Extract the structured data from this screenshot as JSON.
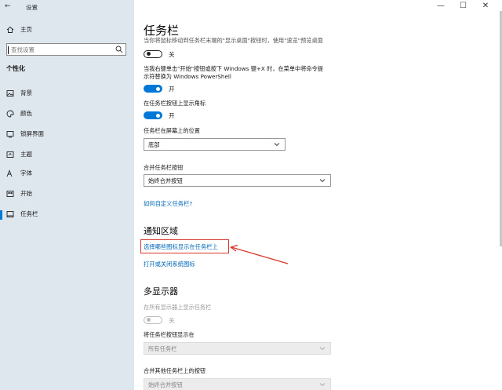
{
  "window": {
    "title": "设置",
    "back_glyph": "←",
    "minimize": "—",
    "maximize": "☐",
    "close": "✕"
  },
  "sidebar": {
    "home": "主页",
    "search_placeholder": "查找设置",
    "section": "个性化",
    "items": [
      {
        "label": "背景",
        "icon": "image-icon"
      },
      {
        "label": "颜色",
        "icon": "palette-icon"
      },
      {
        "label": "锁屏界面",
        "icon": "lock-screen-icon"
      },
      {
        "label": "主题",
        "icon": "theme-icon"
      },
      {
        "label": "字体",
        "icon": "font-icon"
      },
      {
        "label": "开始",
        "icon": "start-icon"
      },
      {
        "label": "任务栏",
        "icon": "taskbar-icon",
        "selected": true
      }
    ]
  },
  "main": {
    "title": "任务栏",
    "peek_desc": "当你将鼠标移动到任务栏末端的\"显示桌面\"按钮时，使用\"速览\"预览桌面",
    "peek_state": "关",
    "powershell_desc_line1": "当我右键单击\"开始\"按钮或按下 Windows 键+X 时，在菜单中将命令提",
    "powershell_desc_line2": "示符替换为 Windows PowerShell",
    "powershell_state": "开",
    "badges_desc": "在任务栏按钮上显示角标",
    "badges_state": "开",
    "location_label": "任务栏在屏幕上的位置",
    "location_value": "底部",
    "combine_label": "合并任务栏按钮",
    "combine_value": "始终合并按钮",
    "customize_link": "如何自定义任务栏?",
    "notification_heading": "通知区域",
    "select_icons_link": "选择哪些图标显示在任务栏上",
    "system_icons_link": "打开或关闭系统图标",
    "multi_heading": "多显示器",
    "show_all_desc": "在所有显示器上显示任务栏",
    "show_all_state": "关",
    "show_buttons_label": "将任务栏按钮显示在",
    "show_buttons_value": "所有任务栏",
    "combine_other_label": "合并其他任务栏上的按钮",
    "combine_other_value": "始终合并按钮"
  },
  "colors": {
    "accent": "#0078d7",
    "link": "#0067b8",
    "highlight": "#d9362b",
    "sidebar_bg": "#dfe7ee"
  }
}
